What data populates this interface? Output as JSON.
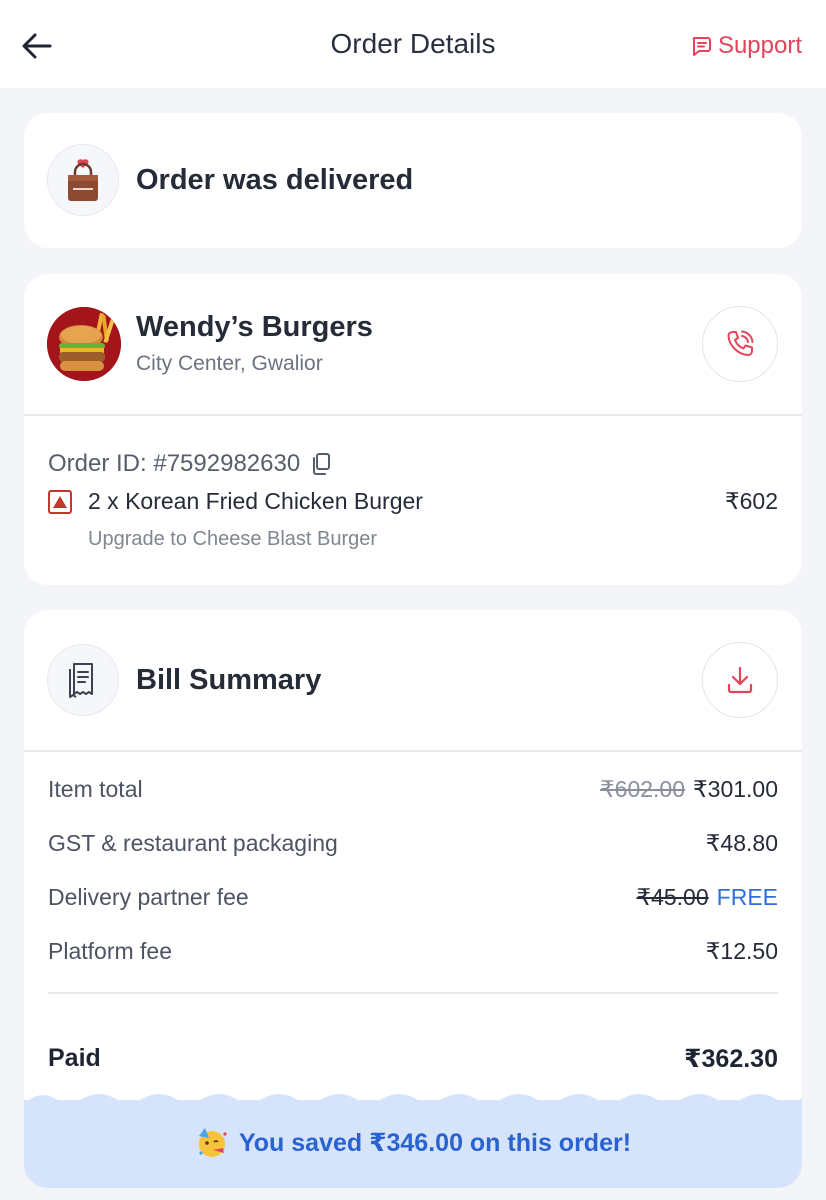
{
  "header": {
    "title": "Order Details",
    "support_label": "Support",
    "back_icon": "arrow-left-icon",
    "support_icon": "chat-icon",
    "accent_color": "#e2455a"
  },
  "status": {
    "text": "Order was delivered",
    "icon": "delivery-bag-icon"
  },
  "restaurant": {
    "name": "Wendy’s Burgers",
    "location": "City Center, Gwalior",
    "call_icon": "phone-call-icon",
    "order_id": "Order ID: #7592982630",
    "copy_icon": "copy-icon",
    "items": [
      {
        "quantity_name": "2 x Korean Fried Chicken Burger",
        "price": "₹602",
        "customization": "Upgrade to Cheese Blast Burger",
        "diet_icon": "non-veg-mark-icon"
      }
    ]
  },
  "bill": {
    "title": "Bill Summary",
    "icon": "receipt-icon",
    "download_icon": "download-icon",
    "rows": [
      {
        "label": "Item total",
        "original": "₹602.00",
        "value": "₹301.00"
      },
      {
        "label": "GST & restaurant packaging",
        "value": "₹48.80"
      },
      {
        "label": "Delivery partner fee",
        "original": "₹45.00",
        "value": "FREE"
      },
      {
        "label": "Platform fee",
        "value": "₹12.50"
      }
    ],
    "paid_label": "Paid",
    "paid_value": "₹362.30",
    "savings_text": "You saved ₹346.00 on this order!",
    "savings_icon": "party-face-emoji",
    "savings_color": "#2a62cf",
    "free_color": "#2f6fd8"
  }
}
